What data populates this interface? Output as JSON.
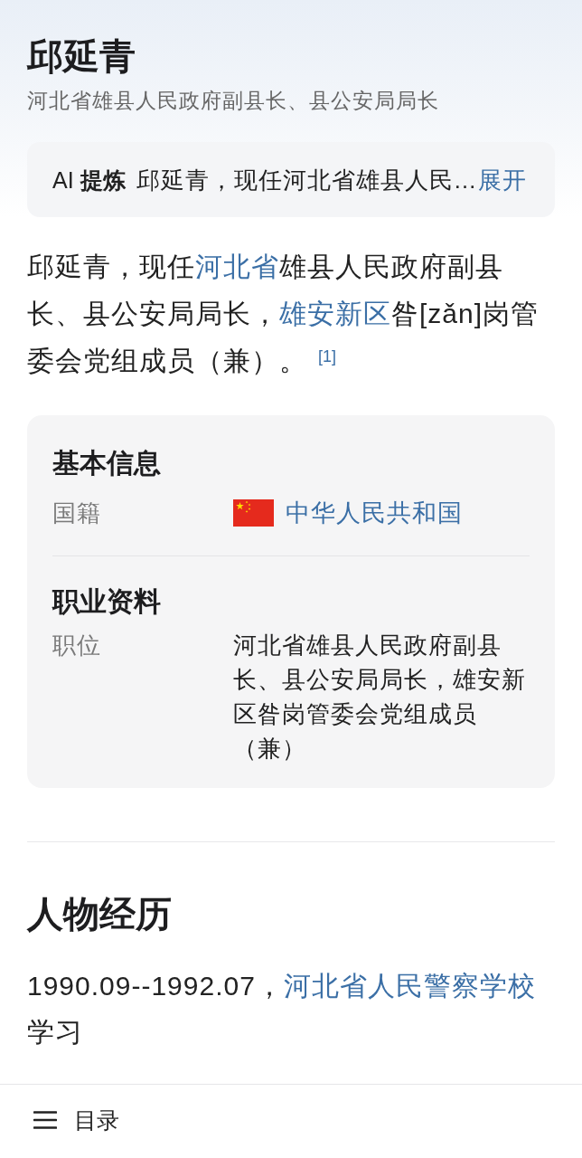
{
  "header": {
    "title": "邱延青",
    "subtitle": "河北省雄县人民政府副县长、县公安局局长"
  },
  "ai_summary": {
    "label": "AI **提炼**",
    "text": "邱延青，现任河北省雄县人民…",
    "expand": "展开"
  },
  "intro": {
    "segments": [
      {
        "kind": "text",
        "text": "邱延青，现任"
      },
      {
        "kind": "link",
        "text": "河北省"
      },
      {
        "kind": "text",
        "text": "雄县人民政府副县长、县公安局局长，"
      },
      {
        "kind": "link",
        "text": "雄安新区"
      },
      {
        "kind": "text",
        "text": "昝[zǎn]岗管委会党组成员（兼）。"
      },
      {
        "kind": "footnote",
        "text": "[1]"
      }
    ]
  },
  "info_card": {
    "sections": [
      {
        "heading": "基本信息",
        "rows": [
          {
            "kind": "flag_link",
            "label": "国籍",
            "value": "中华人民共和国"
          }
        ]
      },
      {
        "heading": "职业资料",
        "rows": [
          {
            "kind": "text",
            "label": "职位",
            "value": "河北省雄县人民政府副县长、县公安局局长，雄安新区昝岗管委会党组成员（兼）"
          }
        ]
      }
    ]
  },
  "career": {
    "heading": "人物经历",
    "entries": [
      {
        "segments": [
          {
            "kind": "text",
            "text": "1990.09--1992.07，"
          },
          {
            "kind": "link",
            "text": "河北省人民警察学校"
          },
          {
            "kind": "text",
            "text": "学习"
          }
        ]
      }
    ]
  },
  "bottom_bar": {
    "toc_label": "目录"
  }
}
